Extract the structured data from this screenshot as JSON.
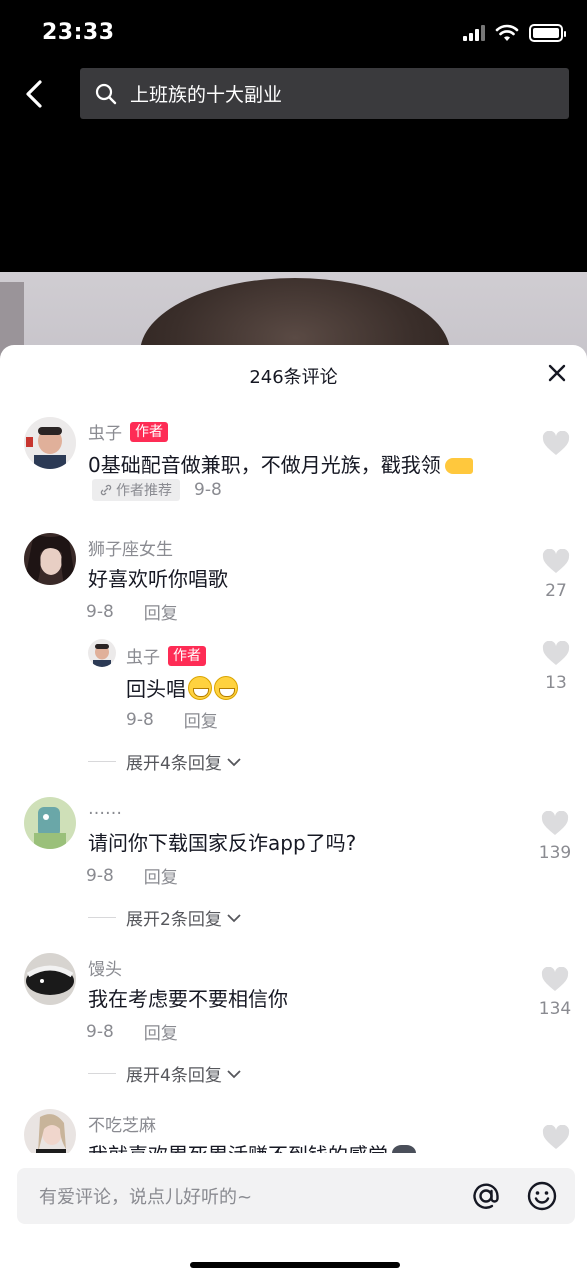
{
  "status_bar": {
    "time": "23:33"
  },
  "search": {
    "query": "上班族的十大副业"
  },
  "sheet": {
    "title": "246条评论"
  },
  "comments": [
    {
      "username": "虫子",
      "author_tag": "作者",
      "text": "0基础配音做兼职，不做月光族，戳我领",
      "pin_label": "作者推荐",
      "date": "9-8"
    },
    {
      "username": "狮子座女生",
      "text": "好喜欢听你唱歌",
      "date": "9-8",
      "reply_label": "回复",
      "likes": "27",
      "reply": {
        "username": "虫子",
        "author_tag": "作者",
        "text": "回头唱",
        "date": "9-8",
        "reply_label": "回复",
        "likes": "13"
      },
      "expand_label": "展开4条回复"
    },
    {
      "username": "……",
      "text": "请问你下载国家反诈app了吗?",
      "date": "9-8",
      "reply_label": "回复",
      "likes": "139",
      "expand_label": "展开2条回复"
    },
    {
      "username": "馒头",
      "text": "我在考虑要不要相信你",
      "date": "9-8",
      "reply_label": "回复",
      "likes": "134",
      "expand_label": "展开4条回复"
    },
    {
      "username": "不吃芝麻",
      "text": "我就喜欢累死累活赚不到钱的感觉"
    }
  ],
  "input": {
    "placeholder": "有爱评论，说点儿好听的~"
  },
  "icons": {
    "back": "chevron-left-icon",
    "search": "search-icon",
    "close": "close-icon",
    "like": "heart-icon",
    "mention": "at-icon",
    "emoji": "smile-icon"
  }
}
